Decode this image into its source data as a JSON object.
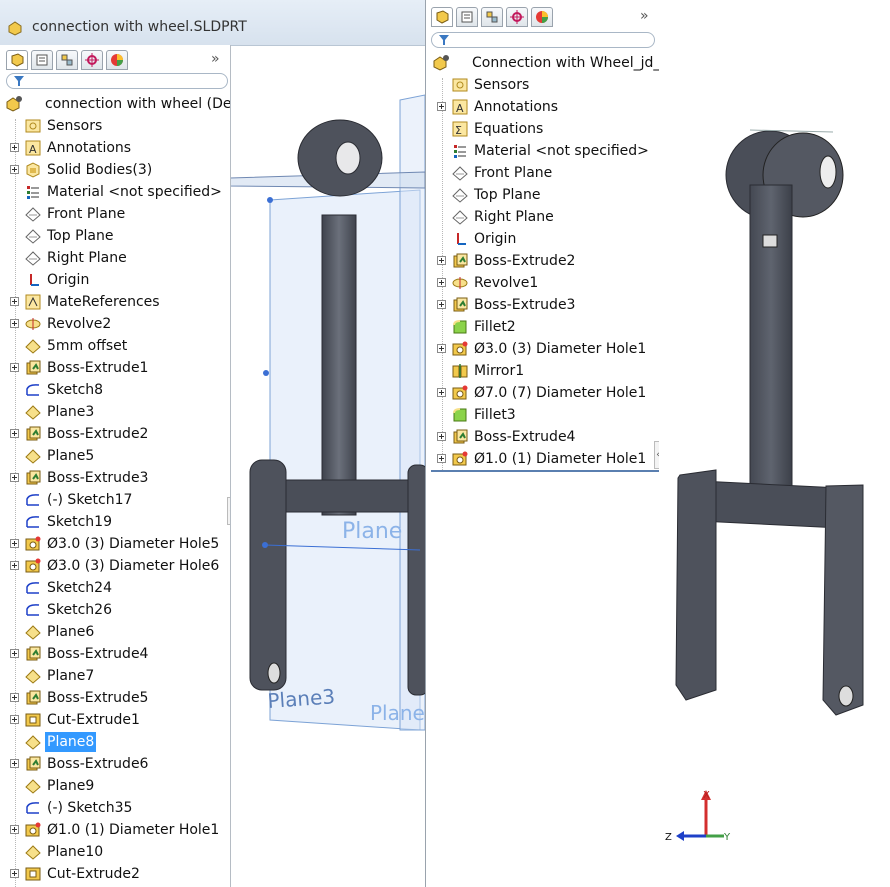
{
  "left_panel": {
    "title": "connection with wheel.SLDPRT",
    "root_label": "connection with wheel  (De",
    "items": [
      {
        "label": "Sensors",
        "icon": "sensors-icon",
        "expand": false
      },
      {
        "label": "Annotations",
        "icon": "annotations-icon",
        "expand": true
      },
      {
        "label": "Solid Bodies(3)",
        "icon": "solid-bodies-icon",
        "expand": true
      },
      {
        "label": "Material <not specified>",
        "icon": "material-icon",
        "expand": false
      },
      {
        "label": "Front Plane",
        "icon": "plane-icon",
        "expand": false
      },
      {
        "label": "Top Plane",
        "icon": "plane-icon",
        "expand": false
      },
      {
        "label": "Right Plane",
        "icon": "plane-icon",
        "expand": false
      },
      {
        "label": "Origin",
        "icon": "origin-icon",
        "expand": false
      },
      {
        "label": "MateReferences",
        "icon": "mate-references-icon",
        "expand": true
      },
      {
        "label": "Revolve2",
        "icon": "revolve-icon",
        "expand": true
      },
      {
        "label": "5mm offset",
        "icon": "ref-plane-icon",
        "expand": false
      },
      {
        "label": "Boss-Extrude1",
        "icon": "boss-extrude-icon",
        "expand": true
      },
      {
        "label": "Sketch8",
        "icon": "sketch-icon",
        "expand": false
      },
      {
        "label": "Plane3",
        "icon": "ref-plane-icon",
        "expand": false
      },
      {
        "label": "Boss-Extrude2",
        "icon": "boss-extrude-icon",
        "expand": true
      },
      {
        "label": "Plane5",
        "icon": "ref-plane-icon",
        "expand": false
      },
      {
        "label": "Boss-Extrude3",
        "icon": "boss-extrude-icon",
        "expand": true
      },
      {
        "label": "(-) Sketch17",
        "icon": "sketch-icon",
        "expand": false
      },
      {
        "label": "Sketch19",
        "icon": "sketch-icon",
        "expand": false
      },
      {
        "label": "Ø3.0 (3) Diameter Hole5",
        "icon": "hole-icon",
        "expand": true
      },
      {
        "label": "Ø3.0 (3) Diameter Hole6",
        "icon": "hole-icon",
        "expand": true
      },
      {
        "label": "Sketch24",
        "icon": "sketch-icon",
        "expand": false
      },
      {
        "label": "Sketch26",
        "icon": "sketch-icon",
        "expand": false
      },
      {
        "label": "Plane6",
        "icon": "ref-plane-icon",
        "expand": false
      },
      {
        "label": "Boss-Extrude4",
        "icon": "boss-extrude-icon",
        "expand": true
      },
      {
        "label": "Plane7",
        "icon": "ref-plane-icon",
        "expand": false
      },
      {
        "label": "Boss-Extrude5",
        "icon": "boss-extrude-icon",
        "expand": true
      },
      {
        "label": "Cut-Extrude1",
        "icon": "cut-extrude-icon",
        "expand": true
      },
      {
        "label": "Plane8",
        "icon": "ref-plane-icon",
        "expand": false,
        "selected": true
      },
      {
        "label": "Boss-Extrude6",
        "icon": "boss-extrude-icon",
        "expand": true
      },
      {
        "label": "Plane9",
        "icon": "ref-plane-icon",
        "expand": false
      },
      {
        "label": "(-) Sketch35",
        "icon": "sketch-icon",
        "expand": false
      },
      {
        "label": "Ø1.0 (1) Diameter Hole1",
        "icon": "hole-icon",
        "expand": true
      },
      {
        "label": "Plane10",
        "icon": "ref-plane-icon",
        "expand": false
      },
      {
        "label": "Cut-Extrude2",
        "icon": "cut-extrude-icon",
        "expand": true
      }
    ]
  },
  "right_panel": {
    "root_label": "Connection with Wheel_jd_r",
    "items": [
      {
        "label": "Sensors",
        "icon": "sensors-icon",
        "expand": false
      },
      {
        "label": "Annotations",
        "icon": "annotations-icon",
        "expand": true
      },
      {
        "label": "Equations",
        "icon": "equations-icon",
        "expand": false
      },
      {
        "label": "Material <not specified>",
        "icon": "material-icon",
        "expand": false
      },
      {
        "label": "Front Plane",
        "icon": "plane-icon",
        "expand": false
      },
      {
        "label": "Top Plane",
        "icon": "plane-icon",
        "expand": false
      },
      {
        "label": "Right Plane",
        "icon": "plane-icon",
        "expand": false
      },
      {
        "label": "Origin",
        "icon": "origin-icon",
        "expand": false
      },
      {
        "label": "Boss-Extrude2",
        "icon": "boss-extrude-icon",
        "expand": true
      },
      {
        "label": "Revolve1",
        "icon": "revolve-icon",
        "expand": true
      },
      {
        "label": "Boss-Extrude3",
        "icon": "boss-extrude-icon",
        "expand": true
      },
      {
        "label": "Fillet2",
        "icon": "fillet-icon",
        "expand": false
      },
      {
        "label": "Ø3.0 (3) Diameter Hole1",
        "icon": "hole-icon",
        "expand": true
      },
      {
        "label": "Mirror1",
        "icon": "mirror-icon",
        "expand": false
      },
      {
        "label": "Ø7.0 (7) Diameter Hole1",
        "icon": "hole-icon",
        "expand": true
      },
      {
        "label": "Fillet3",
        "icon": "fillet-icon",
        "expand": false
      },
      {
        "label": "Boss-Extrude4",
        "icon": "boss-extrude-icon",
        "expand": true
      },
      {
        "label": "Ø1.0 (1) Diameter Hole1",
        "icon": "hole-icon",
        "expand": true
      }
    ]
  },
  "viewport_left": {
    "plane_labels": [
      "Plane3",
      "Plane",
      "Plane"
    ]
  },
  "viewport_right": {
    "triad_labels": {
      "x": "X",
      "y": "Y",
      "z": "Z"
    }
  },
  "colors": {
    "selection": "#3399ff",
    "panel_border": "#9aa3ad",
    "model_face": "#5b5f6a",
    "plane": "#bcd3ee"
  }
}
